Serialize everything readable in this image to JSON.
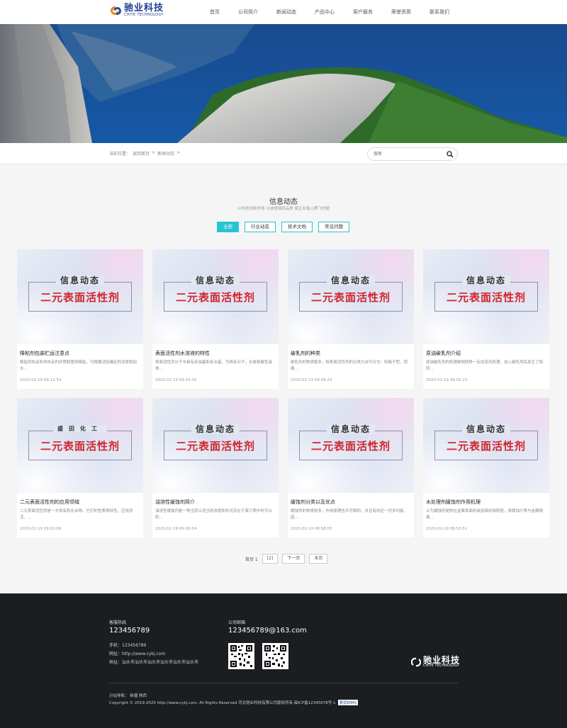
{
  "header": {
    "logo_cn": "驰业科技",
    "logo_en": "CHIYE TECHNOLOGY",
    "nav": [
      "首页",
      "公司简介",
      "新闻动态",
      "产品中心",
      "客户服务",
      "荣誉资质",
      "联系我们"
    ]
  },
  "breadcrumb": {
    "prefix": "当前位置：",
    "home": "返回首页",
    "sep": ">",
    "current": "新闻动态",
    "tail": ">"
  },
  "search": {
    "placeholder": "搜索",
    "icon": "search-icon"
  },
  "section": {
    "title": "信息动态",
    "subtitle": "以科技创新市场 以诚信铸就品质 使企业插上腾飞的翅",
    "tabs": [
      {
        "label": "全部",
        "active": true
      },
      {
        "label": "行业动态",
        "active": false
      },
      {
        "label": "技术文档",
        "active": false
      },
      {
        "label": "常见问题",
        "active": false
      }
    ]
  },
  "cards": [
    {
      "thumb_top": "信息动态",
      "thumb_main": "二元表面活性剂",
      "title": "降粘剂包装贮运注意点",
      "desc": "降粘剂热采和非热采的井筒和管线降粘，可根据试验确定的浓度和加水...",
      "date": "2020-02-19 09:12:54"
    },
    {
      "thumb_top": "信息动态",
      "thumb_main": "二元表面活性剂",
      "title": "表面活性剂水溶液的特性",
      "desc": "表面活性剂分子中具有亲油基和亲水基，为两亲分子。水是极概性液体...",
      "date": "2020-02-19 09:10:32"
    },
    {
      "thumb_top": "信息动态",
      "thumb_main": "二元表面活性剂",
      "title": "破乳剂的种类",
      "desc": "破乳剂的种类繁多，按表面活性剂的分类方法可分为：阳离子型、阴离...",
      "date": "2020-02-19 09:09:24"
    },
    {
      "thumb_top": "信息动态",
      "thumb_main": "二元表面活性剂",
      "title": "原油破乳剂介绍",
      "desc": "原油破乳剂的机理是相转移一反向变形机理。加入破乳剂后发生了相转...",
      "date": "2020-02-19 09:05:23"
    },
    {
      "thumb_top": "盛田化工",
      "thumb_main": "二元表面活性剂",
      "title": "二元表面活性剂的应用领域",
      "desc": "二元表面活性剂是一大类有机化合物，它们的性质再特色，应用灵活、...",
      "date": "2020-02-19 09:02:08"
    },
    {
      "thumb_top": "信息动态",
      "thumb_main": "二元表面活性剂",
      "title": "油溶性缓蚀剂简介",
      "desc": "油溶性缓蚀剂是一种当其以适当的浓度和形式存在于某介质中时可以防...",
      "date": "2020-02-19 09:00:54"
    },
    {
      "thumb_top": "信息动态",
      "thumb_main": "二元表面活性剂",
      "title": "缓蚀剂分类以及优点",
      "desc": "缓蚀剂的种类较多，作用原理也不尽相同，并且有的还一剂多功能，因...",
      "date": "2020-02-19 08:58:05"
    },
    {
      "thumb_top": "信息动态",
      "thumb_main": "二元表面活性剂",
      "title": "水处理剂缓蚀剂作用机理",
      "desc": "认为缓蚀剂是附在金属表面形成连续的吸附层，将腐蚀介质与金属隔离...",
      "date": "2020-02-19 08:53:51"
    }
  ],
  "pager": {
    "prefix": "首页 1",
    "current": "[2]",
    "next": "下一页",
    "last": "末页"
  },
  "footer": {
    "hotline_label": "客服热线",
    "hotline": "123456789",
    "email_label": "公司邮箱",
    "email": "123456789@163.com",
    "phone": "手机：123456789",
    "site": "网址：http://www.cykj.com",
    "address": "地址：汕头市汕头市汕头市汕头市汕头市汕头市",
    "logo_cn": "驰业科技",
    "logo_en": "CHIYE TECHNOLOGY",
    "links_label": "分站导航：",
    "links": [
      "新疆",
      "陕西"
    ],
    "copyright": "Copyright © 2019-2020 http://www.cykj.com. All Rights Reserved 河北驰业科技有限公司版权所有 闽ICP备12345678号-1",
    "badge": "易优EIMS"
  }
}
